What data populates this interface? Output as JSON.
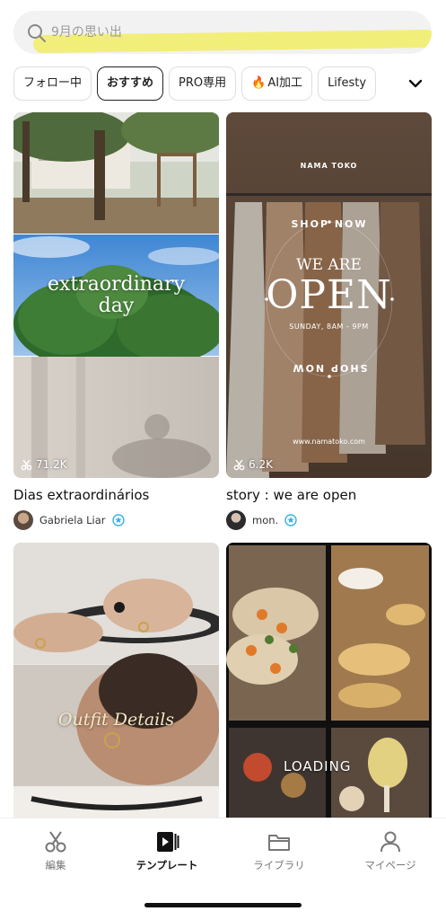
{
  "search": {
    "placeholder": "9月の思い出"
  },
  "chips": [
    {
      "label": "フォロー中"
    },
    {
      "label": "おすすめ"
    },
    {
      "label": "PRO専用"
    },
    {
      "label": "AI加工",
      "emoji": "🔥"
    },
    {
      "label": "Lifesty"
    }
  ],
  "cards": [
    {
      "title": "Dias extraordinários",
      "author": "Gabriela Liar",
      "uses": "71.2K",
      "overlay_line1": "extraordinary",
      "overlay_line2": "day"
    },
    {
      "title": "story : we are open",
      "author": "mon.",
      "uses": "6.2K",
      "brand": "NAMA TOKO",
      "we_are": "WE ARE",
      "open": "OPEN",
      "hours": "SUNDAY, 8AM - 9PM",
      "shop_now": "SHOP NOW",
      "site": "www.namatoko.com"
    },
    {
      "overlay": "Outfit Details"
    },
    {
      "overlay": "LOADING"
    }
  ],
  "tabbar": {
    "items": [
      {
        "label": "編集",
        "icon": "scissors-icon"
      },
      {
        "label": "テンプレート",
        "icon": "template-icon"
      },
      {
        "label": "ライブラリ",
        "icon": "folder-icon"
      },
      {
        "label": "マイページ",
        "icon": "person-icon"
      }
    ]
  }
}
